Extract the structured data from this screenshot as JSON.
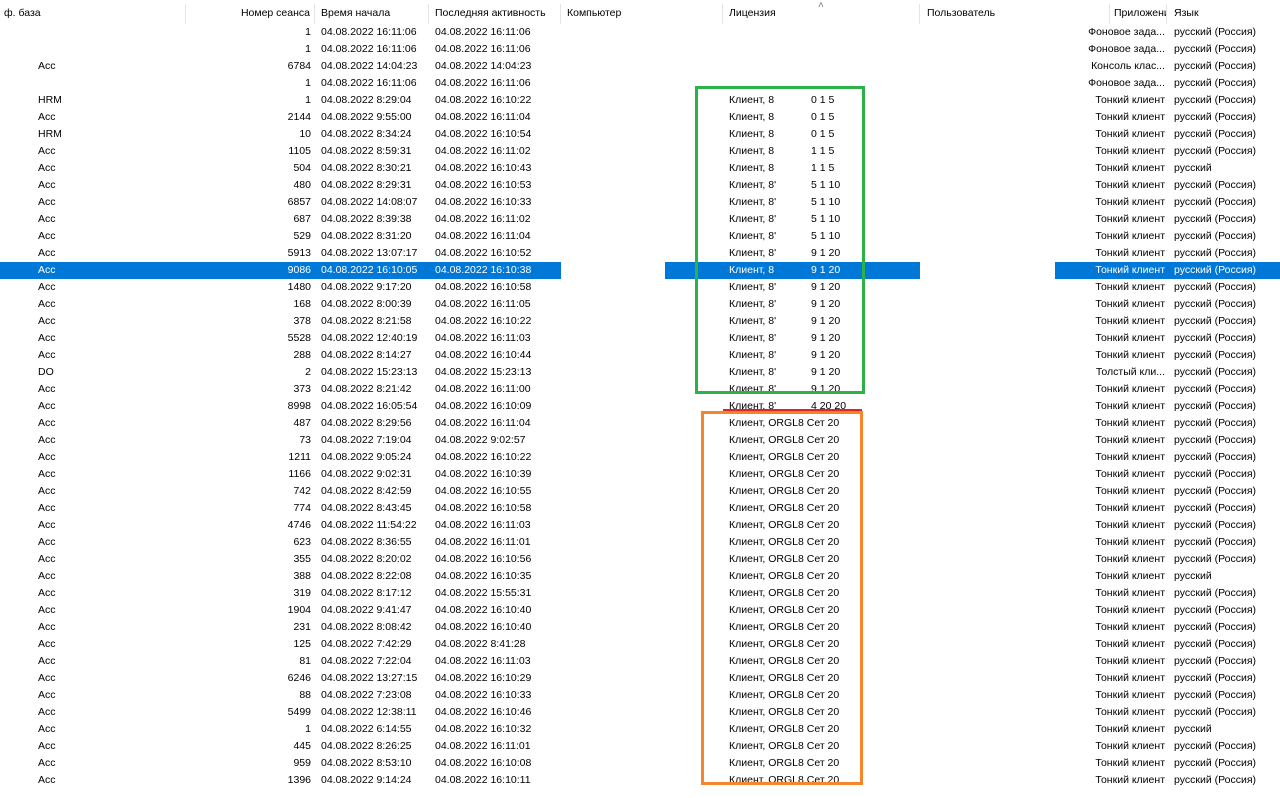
{
  "columns": {
    "base": "ф. база",
    "session": "Номер сеанса",
    "start": "Время начала",
    "last": "Последняя активность",
    "computer": "Компьютер",
    "license": "Лицензия",
    "user": "Пользователь",
    "app": "Приложение",
    "lang": "Язык"
  },
  "colors": {
    "selection": "#0078d7",
    "green_box": "#2db24a",
    "orange_box": "#f7862a",
    "red_line": "#e52222"
  },
  "rows": [
    {
      "base": "",
      "session": "1",
      "start": "04.08.2022 16:11:06",
      "last": "04.08.2022 16:11:06",
      "lic_a": "",
      "lic_b": "",
      "app": "Фоновое зада...",
      "lang": "русский (Россия)"
    },
    {
      "base": "",
      "session": "1",
      "start": "04.08.2022 16:11:06",
      "last": "04.08.2022 16:11:06",
      "lic_a": "",
      "lic_b": "",
      "app": "Фоновое зада...",
      "lang": "русский (Россия)"
    },
    {
      "base": "Acc",
      "session": "6784",
      "start": "04.08.2022 14:04:23",
      "last": "04.08.2022 14:04:23",
      "lic_a": "",
      "lic_b": "",
      "app": "Консоль клас...",
      "lang": "русский (Россия)"
    },
    {
      "base": "",
      "session": "1",
      "start": "04.08.2022 16:11:06",
      "last": "04.08.2022 16:11:06",
      "lic_a": "",
      "lic_b": "",
      "app": "Фоновое зада...",
      "lang": "русский (Россия)"
    },
    {
      "base": "HRM",
      "session": "1",
      "start": "04.08.2022 8:29:04",
      "last": "04.08.2022 16:10:22",
      "lic_a": "Клиент, 8",
      "lic_b": "0 1 5",
      "app": "Тонкий клиент",
      "lang": "русский (Россия)"
    },
    {
      "base": "Acc",
      "session": "2144",
      "start": "04.08.2022 9:55:00",
      "last": "04.08.2022 16:11:04",
      "lic_a": "Клиент, 8",
      "lic_b": "0 1 5",
      "app": "Тонкий клиент",
      "lang": "русский (Россия)"
    },
    {
      "base": "HRM",
      "session": "10",
      "start": "04.08.2022 8:34:24",
      "last": "04.08.2022 16:10:54",
      "lic_a": "Клиент, 8",
      "lic_b": "0 1 5",
      "app": "Тонкий клиент",
      "lang": "русский (Россия)"
    },
    {
      "base": "Acc",
      "session": "1105",
      "start": "04.08.2022 8:59:31",
      "last": "04.08.2022 16:11:02",
      "lic_a": "Клиент, 8",
      "lic_b": "1 1 5",
      "app": "Тонкий клиент",
      "lang": "русский (Россия)"
    },
    {
      "base": "Acc",
      "session": "504",
      "start": "04.08.2022 8:30:21",
      "last": "04.08.2022 16:10:43",
      "lic_a": "Клиент, 8",
      "lic_b": "1 1 5",
      "app": "Тонкий клиент",
      "lang": "русский"
    },
    {
      "base": "Acc",
      "session": "480",
      "start": "04.08.2022 8:29:31",
      "last": "04.08.2022 16:10:53",
      "lic_a": "Клиент, 8'",
      "lic_b": "5 1 10",
      "app": "Тонкий клиент",
      "lang": "русский (Россия)"
    },
    {
      "base": "Acc",
      "session": "6857",
      "start": "04.08.2022 14:08:07",
      "last": "04.08.2022 16:10:33",
      "lic_a": "Клиент, 8'",
      "lic_b": "5 1 10",
      "app": "Тонкий клиент",
      "lang": "русский (Россия)"
    },
    {
      "base": "Acc",
      "session": "687",
      "start": "04.08.2022 8:39:38",
      "last": "04.08.2022 16:11:02",
      "lic_a": "Клиент, 8'",
      "lic_b": "5 1 10",
      "app": "Тонкий клиент",
      "lang": "русский (Россия)"
    },
    {
      "base": "Acc",
      "session": "529",
      "start": "04.08.2022 8:31:20",
      "last": "04.08.2022 16:11:04",
      "lic_a": "Клиент, 8'",
      "lic_b": "5 1 10",
      "app": "Тонкий клиент",
      "lang": "русский (Россия)"
    },
    {
      "base": "Acc",
      "session": "5913",
      "start": "04.08.2022 13:07:17",
      "last": "04.08.2022 16:10:52",
      "lic_a": "Клиент, 8'",
      "lic_b": "9 1 20",
      "app": "Тонкий клиент",
      "lang": "русский (Россия)"
    },
    {
      "base": "Acc",
      "session": "9086",
      "start": "04.08.2022 16:10:05",
      "last": "04.08.2022 16:10:38",
      "lic_a": "Клиент, 8",
      "lic_b": "9 1 20",
      "app": "Тонкий клиент",
      "lang": "русский (Россия)",
      "selected": true
    },
    {
      "base": "Acc",
      "session": "1480",
      "start": "04.08.2022 9:17:20",
      "last": "04.08.2022 16:10:58",
      "lic_a": "Клиент, 8'",
      "lic_b": "9 1 20",
      "app": "Тонкий клиент",
      "lang": "русский (Россия)"
    },
    {
      "base": "Acc",
      "session": "168",
      "start": "04.08.2022 8:00:39",
      "last": "04.08.2022 16:11:05",
      "lic_a": "Клиент, 8'",
      "lic_b": "9 1 20",
      "app": "Тонкий клиент",
      "lang": "русский (Россия)"
    },
    {
      "base": "Acc",
      "session": "378",
      "start": "04.08.2022 8:21:58",
      "last": "04.08.2022 16:10:22",
      "lic_a": "Клиент, 8'",
      "lic_b": "9 1 20",
      "app": "Тонкий клиент",
      "lang": "русский (Россия)"
    },
    {
      "base": "Acc",
      "session": "5528",
      "start": "04.08.2022 12:40:19",
      "last": "04.08.2022 16:11:03",
      "lic_a": "Клиент, 8'",
      "lic_b": "9 1 20",
      "app": "Тонкий клиент",
      "lang": "русский (Россия)"
    },
    {
      "base": "Acc",
      "session": "288",
      "start": "04.08.2022 8:14:27",
      "last": "04.08.2022 16:10:44",
      "lic_a": "Клиент, 8'",
      "lic_b": "9 1 20",
      "app": "Тонкий клиент",
      "lang": "русский (Россия)"
    },
    {
      "base": "DO",
      "session": "2",
      "start": "04.08.2022 15:23:13",
      "last": "04.08.2022 15:23:13",
      "lic_a": "Клиент, 8'",
      "lic_b": "9 1 20",
      "app": "Толстый кли...",
      "lang": "русский (Россия)"
    },
    {
      "base": "Acc",
      "session": "373",
      "start": "04.08.2022 8:21:42",
      "last": "04.08.2022 16:11:00",
      "lic_a": "Клиент, 8'",
      "lic_b": "9 1 20",
      "app": "Тонкий клиент",
      "lang": "русский (Россия)"
    },
    {
      "base": "Acc",
      "session": "8998",
      "start": "04.08.2022 16:05:54",
      "last": "04.08.2022 16:10:09",
      "lic_a": "Клиент, 8'",
      "lic_b": "4 20 20",
      "app": "Тонкий клиент",
      "lang": "русский (Россия)"
    },
    {
      "base": "Acc",
      "session": "487",
      "start": "04.08.2022 8:29:56",
      "last": "04.08.2022 16:11:04",
      "lic_a": "Клиент, ORGL8 Сет 20",
      "lic_b": "",
      "app": "Тонкий клиент",
      "lang": "русский (Россия)"
    },
    {
      "base": "Acc",
      "session": "73",
      "start": "04.08.2022 7:19:04",
      "last": "04.08.2022 9:02:57",
      "lic_a": "Клиент, ORGL8 Сет 20",
      "lic_b": "",
      "app": "Тонкий клиент",
      "lang": "русский (Россия)"
    },
    {
      "base": "Acc",
      "session": "1211",
      "start": "04.08.2022 9:05:24",
      "last": "04.08.2022 16:10:22",
      "lic_a": "Клиент, ORGL8 Сет 20",
      "lic_b": "",
      "app": "Тонкий клиент",
      "lang": "русский (Россия)"
    },
    {
      "base": "Acc",
      "session": "1166",
      "start": "04.08.2022 9:02:31",
      "last": "04.08.2022 16:10:39",
      "lic_a": "Клиент, ORGL8 Сет 20",
      "lic_b": "",
      "app": "Тонкий клиент",
      "lang": "русский (Россия)"
    },
    {
      "base": "Acc",
      "session": "742",
      "start": "04.08.2022 8:42:59",
      "last": "04.08.2022 16:10:55",
      "lic_a": "Клиент, ORGL8 Сет 20",
      "lic_b": "",
      "app": "Тонкий клиент",
      "lang": "русский (Россия)"
    },
    {
      "base": "Acc",
      "session": "774",
      "start": "04.08.2022 8:43:45",
      "last": "04.08.2022 16:10:58",
      "lic_a": "Клиент, ORGL8 Сет 20",
      "lic_b": "",
      "app": "Тонкий клиент",
      "lang": "русский (Россия)"
    },
    {
      "base": "Acc",
      "session": "4746",
      "start": "04.08.2022 11:54:22",
      "last": "04.08.2022 16:11:03",
      "lic_a": "Клиент, ORGL8 Сет 20",
      "lic_b": "",
      "app": "Тонкий клиент",
      "lang": "русский (Россия)"
    },
    {
      "base": "Acc",
      "session": "623",
      "start": "04.08.2022 8:36:55",
      "last": "04.08.2022 16:11:01",
      "lic_a": "Клиент, ORGL8 Сет 20",
      "lic_b": "",
      "app": "Тонкий клиент",
      "lang": "русский (Россия)"
    },
    {
      "base": "Acc",
      "session": "355",
      "start": "04.08.2022 8:20:02",
      "last": "04.08.2022 16:10:56",
      "lic_a": "Клиент, ORGL8 Сет 20",
      "lic_b": "",
      "app": "Тонкий клиент",
      "lang": "русский (Россия)"
    },
    {
      "base": "Acc",
      "session": "388",
      "start": "04.08.2022 8:22:08",
      "last": "04.08.2022 16:10:35",
      "lic_a": "Клиент, ORGL8 Сет 20",
      "lic_b": "",
      "app": "Тонкий клиент",
      "lang": "русский"
    },
    {
      "base": "Acc",
      "session": "319",
      "start": "04.08.2022 8:17:12",
      "last": "04.08.2022 15:55:31",
      "lic_a": "Клиент, ORGL8 Сет 20",
      "lic_b": "",
      "app": "Тонкий клиент",
      "lang": "русский (Россия)"
    },
    {
      "base": "Acc",
      "session": "1904",
      "start": "04.08.2022 9:41:47",
      "last": "04.08.2022 16:10:40",
      "lic_a": "Клиент, ORGL8 Сет 20",
      "lic_b": "",
      "app": "Тонкий клиент",
      "lang": "русский (Россия)"
    },
    {
      "base": "Acc",
      "session": "231",
      "start": "04.08.2022 8:08:42",
      "last": "04.08.2022 16:10:40",
      "lic_a": "Клиент, ORGL8 Сет 20",
      "lic_b": "",
      "app": "Тонкий клиент",
      "lang": "русский (Россия)"
    },
    {
      "base": "Acc",
      "session": "125",
      "start": "04.08.2022 7:42:29",
      "last": "04.08.2022 8:41:28",
      "lic_a": "Клиент, ORGL8 Сет 20",
      "lic_b": "",
      "app": "Тонкий клиент",
      "lang": "русский (Россия)"
    },
    {
      "base": "Acc",
      "session": "81",
      "start": "04.08.2022 7:22:04",
      "last": "04.08.2022 16:11:03",
      "lic_a": "Клиент, ORGL8 Сет 20",
      "lic_b": "",
      "app": "Тонкий клиент",
      "lang": "русский (Россия)"
    },
    {
      "base": "Acc",
      "session": "6246",
      "start": "04.08.2022 13:27:15",
      "last": "04.08.2022 16:10:29",
      "lic_a": "Клиент, ORGL8 Сет 20",
      "lic_b": "",
      "app": "Тонкий клиент",
      "lang": "русский (Россия)"
    },
    {
      "base": "Acc",
      "session": "88",
      "start": "04.08.2022 7:23:08",
      "last": "04.08.2022 16:10:33",
      "lic_a": "Клиент, ORGL8 Сет 20",
      "lic_b": "",
      "app": "Тонкий клиент",
      "lang": "русский (Россия)"
    },
    {
      "base": "Acc",
      "session": "5499",
      "start": "04.08.2022 12:38:11",
      "last": "04.08.2022 16:10:46",
      "lic_a": "Клиент, ORGL8 Сет 20",
      "lic_b": "",
      "app": "Тонкий клиент",
      "lang": "русский (Россия)"
    },
    {
      "base": "Acc",
      "session": "1",
      "start": "04.08.2022 6:14:55",
      "last": "04.08.2022 16:10:32",
      "lic_a": "Клиент, ORGL8 Сет 20",
      "lic_b": "",
      "app": "Тонкий клиент",
      "lang": "русский"
    },
    {
      "base": "Acc",
      "session": "445",
      "start": "04.08.2022 8:26:25",
      "last": "04.08.2022 16:11:01",
      "lic_a": "Клиент, ORGL8 Сет 20",
      "lic_b": "",
      "app": "Тонкий клиент",
      "lang": "русский (Россия)"
    },
    {
      "base": "Acc",
      "session": "959",
      "start": "04.08.2022 8:53:10",
      "last": "04.08.2022 16:10:08",
      "lic_a": "Клиент, ORGL8 Сет 20",
      "lic_b": "",
      "app": "Тонкий клиент",
      "lang": "русский (Россия)"
    },
    {
      "base": "Acc",
      "session": "1396",
      "start": "04.08.2022 9:14:24",
      "last": "04.08.2022 16:10:11",
      "lic_a": "Клиент, ORGL8 Сет 20",
      "lic_b": "",
      "app": "Тонкий клиент",
      "lang": "русский (Россия)"
    }
  ]
}
